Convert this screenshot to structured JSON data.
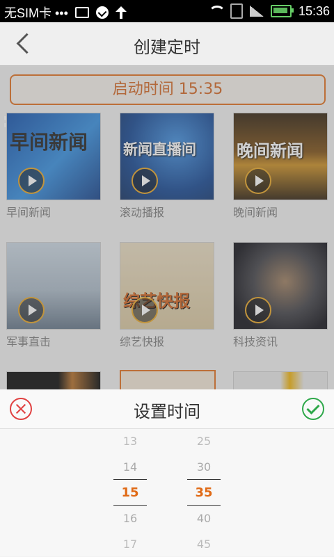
{
  "status_bar": {
    "carrier": "无SIM卡 •••",
    "time": "15:36"
  },
  "header": {
    "title": "创建定时"
  },
  "start_time_label": "启动时间 15:35",
  "channels": [
    {
      "name": "早间新闻",
      "thumb_text": "早间新闻"
    },
    {
      "name": "滚动播报",
      "thumb_text": "新闻直播间"
    },
    {
      "name": "晚间新闻",
      "thumb_text": "晚间新闻"
    },
    {
      "name": "军事直击",
      "thumb_text": ""
    },
    {
      "name": "综艺快报",
      "thumb_text": "综艺快报"
    },
    {
      "name": "科技资讯",
      "thumb_text": ""
    }
  ],
  "time_picker": {
    "title": "设置时间",
    "hours": [
      "13",
      "14",
      "15",
      "16",
      "17"
    ],
    "minutes": [
      "25",
      "30",
      "35",
      "40",
      "45"
    ],
    "selected_hour": "15",
    "selected_minute": "35"
  },
  "colors": {
    "accent": "#e06a16",
    "cancel": "#e04040",
    "confirm": "#2ea84a"
  }
}
